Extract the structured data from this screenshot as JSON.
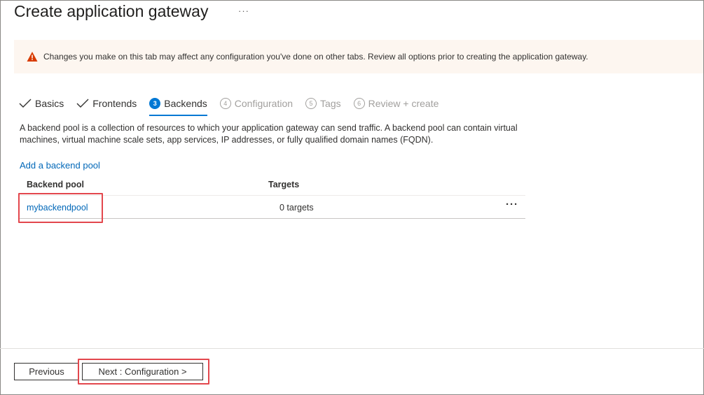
{
  "header": {
    "title": "Create application gateway",
    "more_label": "···"
  },
  "warning": {
    "icon": "warning-icon",
    "text": "Changes you make on this tab may affect any configuration you've done on other tabs. Review all options prior to creating the application gateway."
  },
  "tabs": [
    {
      "label": "Basics",
      "state": "completed",
      "number": ""
    },
    {
      "label": "Frontends",
      "state": "completed",
      "number": ""
    },
    {
      "label": "Backends",
      "state": "active",
      "number": "3"
    },
    {
      "label": "Configuration",
      "state": "disabled",
      "number": "4"
    },
    {
      "label": "Tags",
      "state": "disabled",
      "number": "5"
    },
    {
      "label": "Review + create",
      "state": "disabled",
      "number": "6"
    }
  ],
  "main": {
    "description": "A backend pool is a collection of resources to which your application gateway can send traffic. A backend pool can contain virtual machines, virtual machine scale sets, app services, IP addresses, or fully qualified domain names (FQDN).",
    "add_link": "Add a backend pool",
    "table": {
      "columns": [
        "Backend pool",
        "Targets"
      ],
      "rows": [
        {
          "pool": "mybackendpool",
          "targets": "0 targets",
          "more": "···"
        }
      ]
    }
  },
  "footer": {
    "previous_label": "Previous",
    "next_label": "Next : Configuration >"
  },
  "colors": {
    "accent": "#0078d4",
    "link": "#0067b8",
    "warning": "#d83b01",
    "highlight": "#e3474d"
  }
}
